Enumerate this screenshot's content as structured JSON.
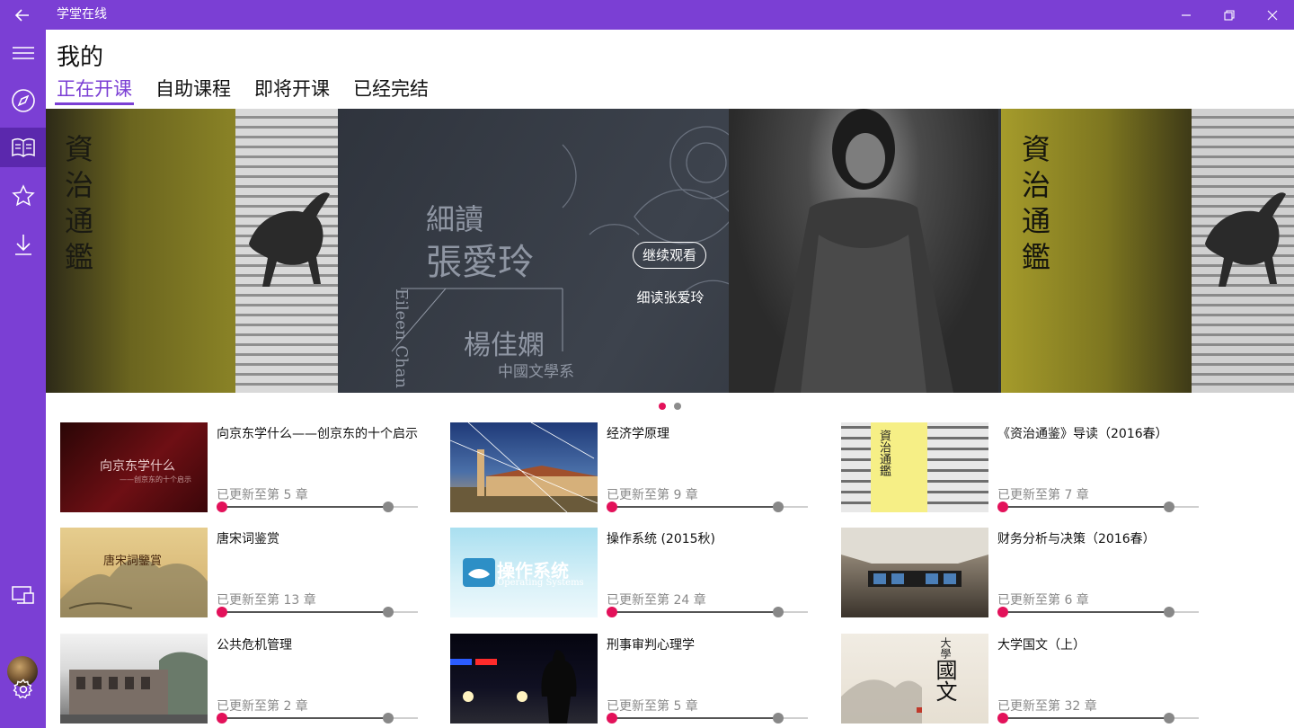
{
  "app": {
    "title": "学堂在线"
  },
  "page": {
    "title": "我的"
  },
  "tabs": [
    {
      "label": "正在开课",
      "active": true
    },
    {
      "label": "自助课程",
      "active": false
    },
    {
      "label": "即将开课",
      "active": false
    },
    {
      "label": "已经完结",
      "active": false
    }
  ],
  "banner": {
    "button_label": "继续观看",
    "subtitle": "细读张爱玲",
    "scroll_text": "資治通鑑",
    "art_title": "細讀",
    "art_name": "張愛玲",
    "art_author": "楊佳嫻",
    "art_dept": "中國文學系",
    "art_en": "Eileen Chan",
    "slides": 2,
    "active_slide": 0
  },
  "progress_prefix": "已更新至第",
  "progress_suffix": "章",
  "courses": [
    {
      "title": "向京东学什么——创京东的十个启示",
      "updated": "已更新至第 5 章",
      "progress": 0.85,
      "thumb_text": "向京东学什么",
      "thumb_sub": "——创京东的十个启示"
    },
    {
      "title": "经济学原理",
      "updated": "已更新至第 9 章",
      "progress": 0.85
    },
    {
      "title": "《资治通鉴》导读（2016春）",
      "updated": "已更新至第 7 章",
      "progress": 0.85,
      "thumb_text": "資治通鑑"
    },
    {
      "title": "唐宋词鉴赏",
      "updated": "已更新至第 13 章",
      "progress": 0.85,
      "thumb_text": "唐宋詞鑒賞"
    },
    {
      "title": "操作系统 (2015秋)",
      "updated": "已更新至第 24 章",
      "progress": 0.85,
      "thumb_text": "操作系统",
      "thumb_sub": "Operating Systems"
    },
    {
      "title": "财务分析与决策（2016春）",
      "updated": "已更新至第 6 章",
      "progress": 0.85
    },
    {
      "title": "公共危机管理",
      "updated": "已更新至第 2 章",
      "progress": 0.85
    },
    {
      "title": "刑事审判心理学",
      "updated": "已更新至第 5 章",
      "progress": 0.85
    },
    {
      "title": "大学国文（上）",
      "updated": "已更新至第 32 章",
      "progress": 0.85,
      "thumb_text": "國文",
      "thumb_sub": "大學"
    }
  ],
  "colors": {
    "accent": "#7b3fd4",
    "sidebar_active": "#5b28ad",
    "progress_start": "#e3115a"
  },
  "icons": {
    "back": "arrow-left-icon",
    "menu": "hamburger-icon",
    "explore": "compass-icon",
    "courses": "book-icon",
    "favorites": "star-icon",
    "downloads": "download-icon",
    "cast": "cast-screen-icon",
    "settings": "gear-icon"
  }
}
